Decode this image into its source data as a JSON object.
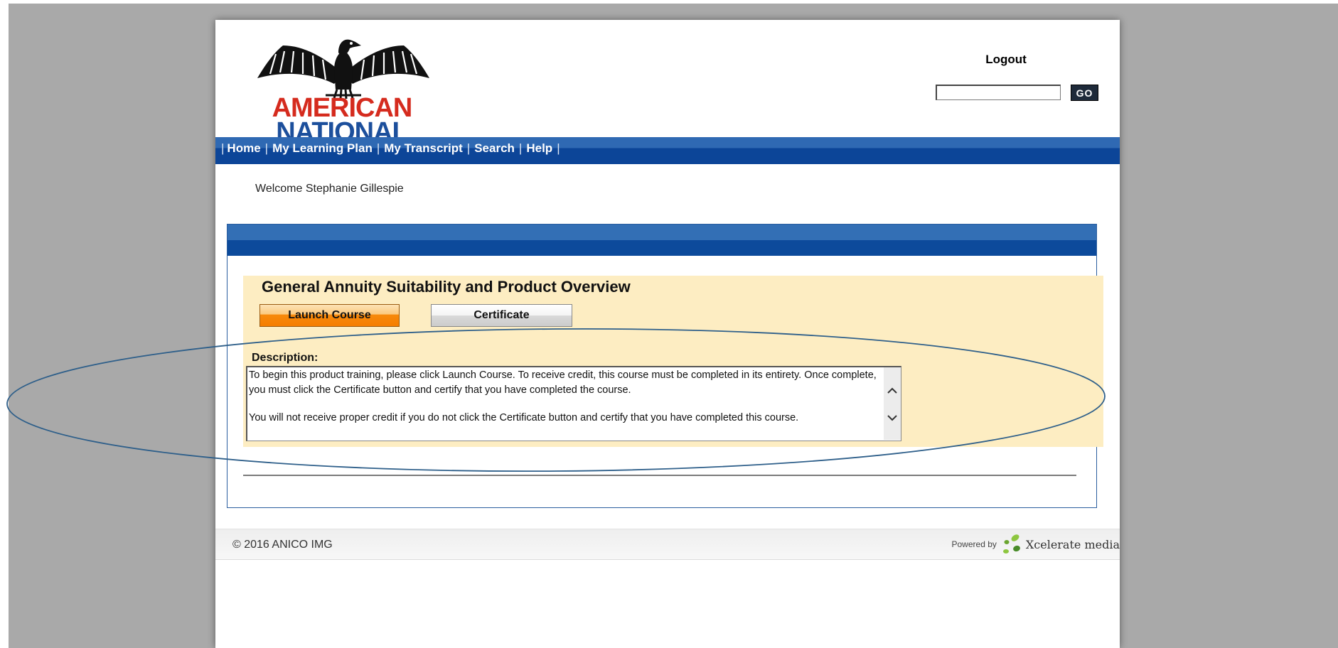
{
  "header": {
    "logo_line1": "AMERICAN",
    "logo_line2": "NATIONAL",
    "logout_label": "Logout",
    "search_value": "",
    "go_label": "GO"
  },
  "nav": {
    "items": [
      "Home",
      "My Learning Plan",
      "My Transcript",
      "Search",
      "Help"
    ],
    "separator": "|"
  },
  "welcome_text": "Welcome Stephanie Gillespie",
  "course": {
    "title": "General Annuity Suitability and Product Overview",
    "launch_label": "Launch Course",
    "certificate_label": "Certificate",
    "description_label": "Description:",
    "description_p1": "To begin this product training, please click Launch Course.  To receive credit, this course must be completed in its entirety.  Once complete, you must click the Certificate button and certify that you have completed the course.",
    "description_p2": "You will not receive proper credit if you do not click the Certificate button and certify that you have completed this course."
  },
  "footer": {
    "copyright": "© 2016  ANICO IMG",
    "powered_by": "Powered by",
    "brand": "Xcelerate media"
  },
  "colors": {
    "nav_blue": "#0c4598",
    "logo_red": "#d52b1e",
    "logo_blue": "#1c4f9c",
    "course_bg": "#fdedc2",
    "launch_orange": "#f57d00",
    "annotation_ellipse": "#2e5f8a"
  },
  "icons": {
    "logo": "eagle-logo-icon",
    "scroll_up": "chevron-up-icon",
    "scroll_down": "chevron-down-icon",
    "brand": "xcelerate-leaf-icon"
  }
}
